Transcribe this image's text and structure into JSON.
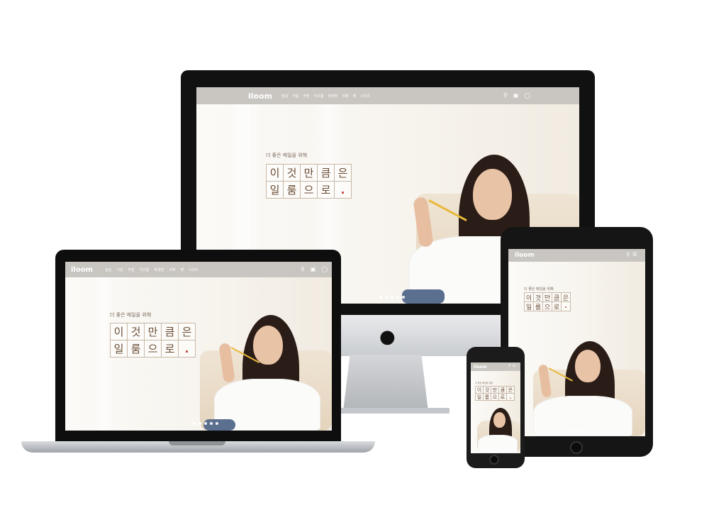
{
  "site": {
    "logo": "iloom",
    "menu": [
      "침실",
      "거실",
      "주방",
      "키즈룸",
      "학생방",
      "서재",
      "펫",
      "시리즈"
    ],
    "tagline": "더 좋은 매일을 위해",
    "headline_row1": [
      "이",
      "것",
      "만",
      "큼",
      "은"
    ],
    "headline_row2": [
      "일",
      "룸",
      "으",
      "로",
      "."
    ]
  },
  "icons": [
    "search-icon",
    "cart-icon",
    "user-icon",
    "menu-icon",
    "apple-logo-icon"
  ],
  "colors": {
    "navbar": "#c9c6c1",
    "headline_text": "#6b4c33",
    "accent_dot": "#c0392b",
    "tagline": "#7a6a5c"
  },
  "slider": {
    "slides": 5,
    "active": 1
  }
}
